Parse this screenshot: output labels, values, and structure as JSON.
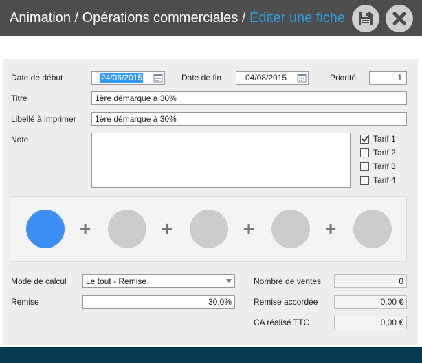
{
  "header": {
    "breadcrumb_1": "Animation",
    "sep_1": " / ",
    "breadcrumb_2": "Opérations commerciales",
    "sep_2": " / ",
    "current": "Éditer une fiche",
    "save_icon": "floppy-disk-icon",
    "close_icon": "close-x-icon",
    "current_color": "#2e9fe0",
    "bar_color": "#4d4d4d"
  },
  "form": {
    "start_date_label": "Date de début",
    "start_date_value": "24/06/2015",
    "end_date_label": "Date de fin",
    "end_date_value": "04/08/2015",
    "priority_label": "Priorité",
    "priority_value": "1",
    "title_label": "Titre",
    "title_value": "1ère démarque à 30%",
    "print_label": "Libellé à imprimer",
    "print_value": "1ère démarque à 30%",
    "note_label": "Note",
    "note_value": "",
    "tarifs": [
      {
        "label": "Tarif 1",
        "checked": true
      },
      {
        "label": "Tarif 2",
        "checked": false
      },
      {
        "label": "Tarif 3",
        "checked": false
      },
      {
        "label": "Tarif 4",
        "checked": false
      }
    ],
    "steps": {
      "count": 5,
      "active_index": 0,
      "plus_symbol": "+",
      "active_color": "#3d8ef5",
      "inactive_color": "#cccccc"
    },
    "calc_mode_label": "Mode de calcul",
    "calc_mode_value": "Le tout - Remise",
    "discount_label": "Remise",
    "discount_value": "30,0%",
    "sales_count_label": "Nombre de ventes",
    "sales_count_value": "0",
    "granted_discount_label": "Remise accordée",
    "granted_discount_value": "0,00 €",
    "revenue_label": "CA réalisé TTC",
    "revenue_value": "0,00 €"
  },
  "footer_color": "#073a4e"
}
